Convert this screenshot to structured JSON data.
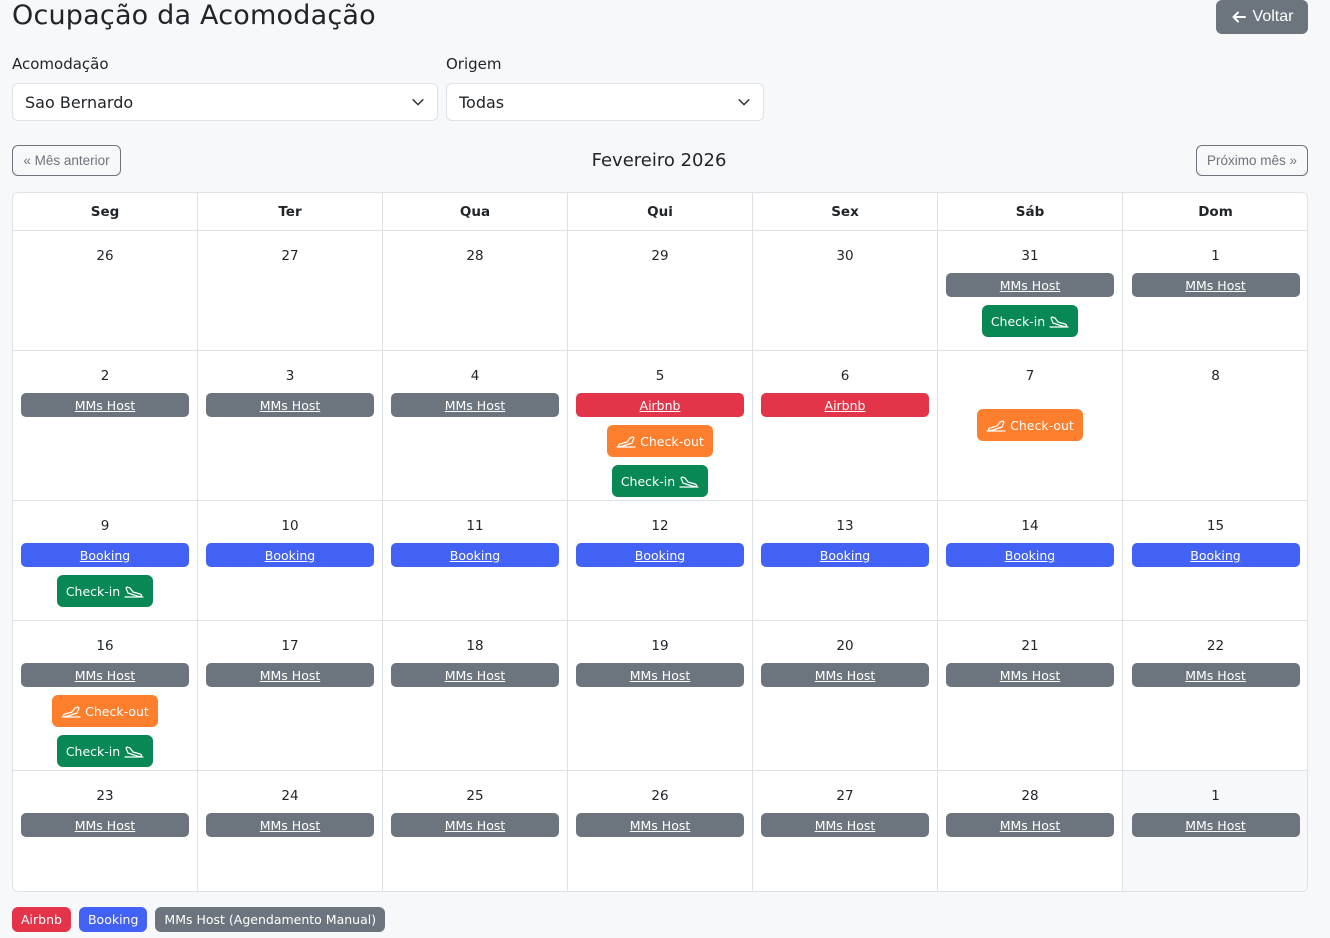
{
  "page": {
    "title": "Ocupação da Acomodação",
    "back_label": "Voltar"
  },
  "filters": {
    "acomodacao_label": "Acomodação",
    "acomodacao_value": "Sao Bernardo",
    "origem_label": "Origem",
    "origem_value": "Todas"
  },
  "nav": {
    "prev_label": "« Mês anterior",
    "next_label": "Próximo mês »",
    "month": "Fevereiro 2026"
  },
  "weekdays": [
    "Seg",
    "Ter",
    "Qua",
    "Qui",
    "Sex",
    "Sáb",
    "Dom"
  ],
  "labels": {
    "checkin": "Check-in",
    "checkout": "Check-out"
  },
  "weeks": [
    {
      "height": 120,
      "days": [
        {
          "n": "26",
          "other": false,
          "bars": [],
          "events": []
        },
        {
          "n": "27",
          "other": false,
          "bars": [],
          "events": []
        },
        {
          "n": "28",
          "other": false,
          "bars": [],
          "events": []
        },
        {
          "n": "29",
          "other": false,
          "bars": [],
          "events": []
        },
        {
          "n": "30",
          "other": false,
          "bars": [],
          "events": []
        },
        {
          "n": "31",
          "other": false,
          "bars": [
            {
              "type": "mms",
              "label": "MMs Host"
            }
          ],
          "events": [
            "checkin"
          ]
        },
        {
          "n": "1",
          "other": false,
          "bars": [
            {
              "type": "mms",
              "label": "MMs Host"
            }
          ],
          "events": []
        }
      ]
    },
    {
      "height": 150,
      "days": [
        {
          "n": "2",
          "other": false,
          "bars": [
            {
              "type": "mms",
              "label": "MMs Host"
            }
          ],
          "events": []
        },
        {
          "n": "3",
          "other": false,
          "bars": [
            {
              "type": "mms",
              "label": "MMs Host"
            }
          ],
          "events": []
        },
        {
          "n": "4",
          "other": false,
          "bars": [
            {
              "type": "mms",
              "label": "MMs Host"
            }
          ],
          "events": []
        },
        {
          "n": "5",
          "other": false,
          "bars": [
            {
              "type": "airbnb",
              "label": "Airbnb"
            }
          ],
          "events": [
            "checkout",
            "checkin"
          ]
        },
        {
          "n": "6",
          "other": false,
          "bars": [
            {
              "type": "airbnb",
              "label": "Airbnb"
            }
          ],
          "events": []
        },
        {
          "n": "7",
          "other": false,
          "bars": [],
          "events": [
            "checkout"
          ]
        },
        {
          "n": "8",
          "other": false,
          "bars": [],
          "events": []
        }
      ]
    },
    {
      "height": 120,
      "days": [
        {
          "n": "9",
          "other": false,
          "bars": [
            {
              "type": "booking",
              "label": "Booking"
            }
          ],
          "events": [
            "checkin"
          ]
        },
        {
          "n": "10",
          "other": false,
          "bars": [
            {
              "type": "booking",
              "label": "Booking"
            }
          ],
          "events": []
        },
        {
          "n": "11",
          "other": false,
          "bars": [
            {
              "type": "booking",
              "label": "Booking"
            }
          ],
          "events": []
        },
        {
          "n": "12",
          "other": false,
          "bars": [
            {
              "type": "booking",
              "label": "Booking"
            }
          ],
          "events": []
        },
        {
          "n": "13",
          "other": false,
          "bars": [
            {
              "type": "booking",
              "label": "Booking"
            }
          ],
          "events": []
        },
        {
          "n": "14",
          "other": false,
          "bars": [
            {
              "type": "booking",
              "label": "Booking"
            }
          ],
          "events": []
        },
        {
          "n": "15",
          "other": false,
          "bars": [
            {
              "type": "booking",
              "label": "Booking"
            }
          ],
          "events": []
        }
      ]
    },
    {
      "height": 150,
      "days": [
        {
          "n": "16",
          "other": false,
          "bars": [
            {
              "type": "mms",
              "label": "MMs Host"
            }
          ],
          "events": [
            "checkout",
            "checkin"
          ]
        },
        {
          "n": "17",
          "other": false,
          "bars": [
            {
              "type": "mms",
              "label": "MMs Host"
            }
          ],
          "events": []
        },
        {
          "n": "18",
          "other": false,
          "bars": [
            {
              "type": "mms",
              "label": "MMs Host"
            }
          ],
          "events": []
        },
        {
          "n": "19",
          "other": false,
          "bars": [
            {
              "type": "mms",
              "label": "MMs Host"
            }
          ],
          "events": []
        },
        {
          "n": "20",
          "other": false,
          "bars": [
            {
              "type": "mms",
              "label": "MMs Host"
            }
          ],
          "events": []
        },
        {
          "n": "21",
          "other": false,
          "bars": [
            {
              "type": "mms",
              "label": "MMs Host"
            }
          ],
          "events": []
        },
        {
          "n": "22",
          "other": false,
          "bars": [
            {
              "type": "mms",
              "label": "MMs Host"
            }
          ],
          "events": []
        }
      ]
    },
    {
      "height": 120,
      "days": [
        {
          "n": "23",
          "other": false,
          "bars": [
            {
              "type": "mms",
              "label": "MMs Host"
            }
          ],
          "events": []
        },
        {
          "n": "24",
          "other": false,
          "bars": [
            {
              "type": "mms",
              "label": "MMs Host"
            }
          ],
          "events": []
        },
        {
          "n": "25",
          "other": false,
          "bars": [
            {
              "type": "mms",
              "label": "MMs Host"
            }
          ],
          "events": []
        },
        {
          "n": "26",
          "other": false,
          "bars": [
            {
              "type": "mms",
              "label": "MMs Host"
            }
          ],
          "events": []
        },
        {
          "n": "27",
          "other": false,
          "bars": [
            {
              "type": "mms",
              "label": "MMs Host"
            }
          ],
          "events": []
        },
        {
          "n": "28",
          "other": false,
          "bars": [
            {
              "type": "mms",
              "label": "MMs Host"
            }
          ],
          "events": []
        },
        {
          "n": "1",
          "other": true,
          "bars": [
            {
              "type": "mms",
              "label": "MMs Host"
            }
          ],
          "events": []
        }
      ]
    }
  ],
  "legend": [
    {
      "label": "Airbnb",
      "color": "#e4344a"
    },
    {
      "label": "Booking",
      "color": "#4261f5"
    },
    {
      "label": "MMs Host (Agendamento Manual)",
      "color": "#6c757d"
    }
  ],
  "colors": {
    "checkin": "#078855",
    "checkout": "#fd7e2c",
    "mms": "#6c757d",
    "airbnb": "#e4344a",
    "booking": "#4261f5"
  }
}
